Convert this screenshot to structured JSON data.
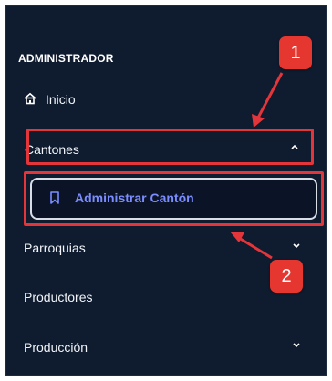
{
  "sidebar": {
    "section_title": "ADMINISTRADOR",
    "items": [
      {
        "label": "Inicio",
        "icon": "home-icon"
      },
      {
        "label": "Cantones",
        "icon": "chevron-up-icon",
        "expanded": true
      },
      {
        "label": "Parroquias",
        "icon": "chevron-down-icon"
      },
      {
        "label": "Productores"
      },
      {
        "label": "Producción",
        "icon": "chevron-down-icon"
      }
    ],
    "submenu": {
      "label": "Administrar Cantón",
      "icon": "bookmark-icon"
    }
  },
  "annotations": {
    "badge_1": "1",
    "badge_2": "2",
    "highlight_color": "#e3353a"
  }
}
